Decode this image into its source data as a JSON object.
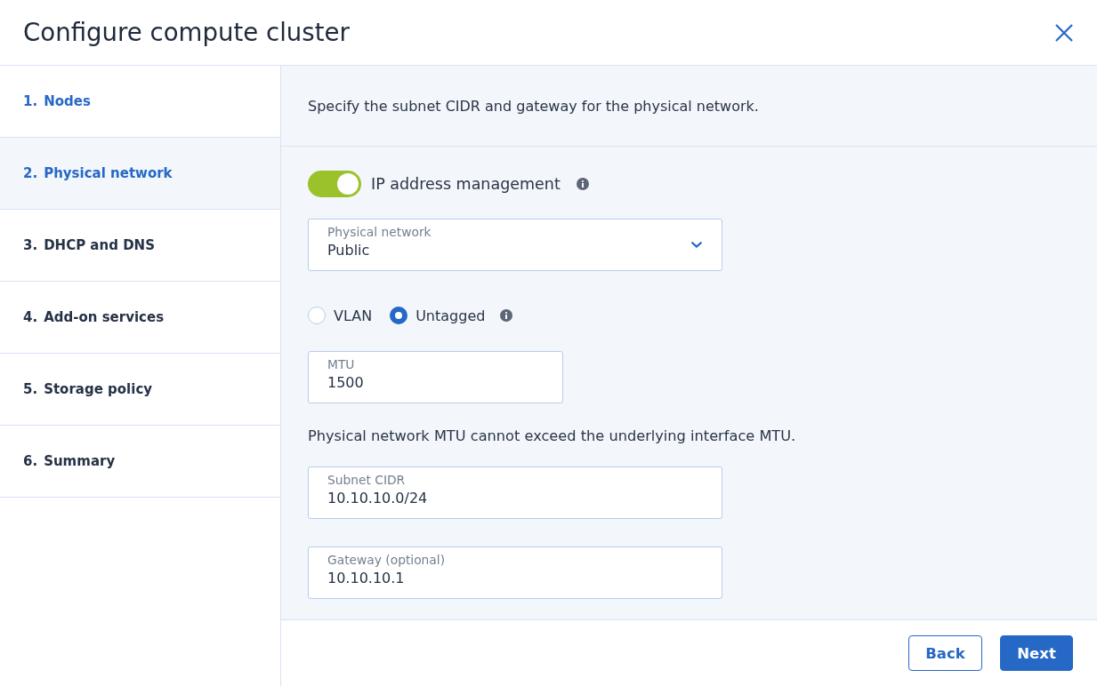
{
  "window": {
    "title": "Configure compute cluster"
  },
  "steps": [
    {
      "number": "1.",
      "label": "Nodes",
      "selected": false,
      "completed": true
    },
    {
      "number": "2.",
      "label": "Physical network",
      "selected": true,
      "completed": false
    },
    {
      "number": "3.",
      "label": "DHCP and DNS",
      "selected": false,
      "completed": false
    },
    {
      "number": "4.",
      "label": "Add-on services",
      "selected": false,
      "completed": false
    },
    {
      "number": "5.",
      "label": "Storage policy",
      "selected": false,
      "completed": false
    },
    {
      "number": "6.",
      "label": "Summary",
      "selected": false,
      "completed": false
    }
  ],
  "intro": "Specify the subnet CIDR and gateway for the physical network.",
  "form": {
    "ip_management": {
      "label": "IP address management",
      "on": true
    },
    "physical_network": {
      "label": "Physical network",
      "value": "Public"
    },
    "tagging": {
      "options": [
        {
          "label": "VLAN",
          "selected": false
        },
        {
          "label": "Untagged",
          "selected": true
        }
      ]
    },
    "mtu": {
      "label": "MTU",
      "value": "1500"
    },
    "mtu_note": "Physical network MTU cannot exceed the underlying interface MTU.",
    "subnet_cidr": {
      "label": "Subnet CIDR",
      "value": "10.10.10.0/24"
    },
    "gateway": {
      "label": "Gateway (optional)",
      "value": "10.10.10.1"
    }
  },
  "buttons": [
    {
      "label": "Back",
      "kind": "secondary"
    },
    {
      "label": "Next",
      "kind": "primary"
    }
  ]
}
